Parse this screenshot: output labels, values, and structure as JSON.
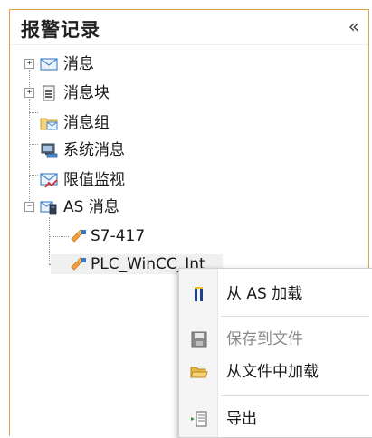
{
  "panel": {
    "title": "报警记录",
    "collapse_glyph": "«"
  },
  "tree": {
    "items": [
      {
        "label": "消息",
        "icon": "mail-icon",
        "expander": "+"
      },
      {
        "label": "消息块",
        "icon": "document-icon",
        "expander": "+"
      },
      {
        "label": "消息组",
        "icon": "folder-mail-icon"
      },
      {
        "label": "系统消息",
        "icon": "computer-icon"
      },
      {
        "label": "限值监视",
        "icon": "limit-mail-icon"
      },
      {
        "label": "AS 消息",
        "icon": "server-mail-icon",
        "expander": "−"
      },
      {
        "label": "S7-417",
        "icon": "plc-connection-icon"
      },
      {
        "label": "PLC_WinCC_Int",
        "icon": "plc-connection-icon",
        "selected": true
      }
    ]
  },
  "context_menu": {
    "items": [
      {
        "label": "从 AS 加载",
        "icon": "as-load-icon",
        "enabled": true
      },
      {
        "label": "保存到文件",
        "icon": "save-icon",
        "enabled": false
      },
      {
        "label": "从文件中加载",
        "icon": "open-folder-icon",
        "enabled": true
      },
      {
        "label": "导出",
        "icon": "export-icon",
        "enabled": true
      }
    ]
  },
  "colors": {
    "panel_border": "#e2a24a",
    "mail_blue": "#4a86c8",
    "folder_yellow": "#e8b84a",
    "alert_red": "#d03030"
  }
}
